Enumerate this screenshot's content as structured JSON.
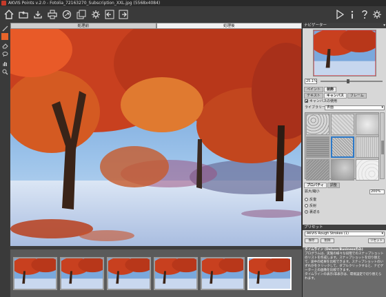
{
  "window": {
    "title": "AKVIS Points v.2.0 - Fotolia_72163270_Subscription_XXL.jpg (5568x4084)"
  },
  "toolbar": {
    "icons": [
      "home-icon",
      "open-icon",
      "save-icon",
      "print-icon",
      "share-icon",
      "batch-icon",
      "back-icon",
      "forward-icon",
      "run-icon",
      "info-icon",
      "help-icon",
      "settings-icon"
    ]
  },
  "view_tabs": {
    "before": "処理前",
    "after": "処理後"
  },
  "navigator": {
    "header": "ナビゲーター",
    "zoom": "25.1%"
  },
  "panel": {
    "tabs_top": [
      "ペイント",
      "装飾"
    ],
    "tabs_sub": [
      "テキスト",
      "キャンバス",
      "フレーム"
    ],
    "canvas_checkbox": "キャンバスの使用",
    "library_label": "ライブラリー",
    "library_value": "表面",
    "props_tabs": [
      "プロパティ",
      "調整"
    ],
    "scale_label": "拡大/縮小",
    "scale_value": "200%",
    "options": [
      "反復",
      "反射",
      "裏返る"
    ],
    "selected_option": 2
  },
  "presets": {
    "header": "プリセット",
    "value": "AKVIS Rough Strokes (1)",
    "save": "保存",
    "delete": "削除",
    "reset": "リセット"
  },
  "info": {
    "title": "タイムライン (Deluxe/Businessのみ)",
    "body": "プログラムは、実施の様々な段階でのスナップショットのリストを作成します。スナップショットを切り替えて、途中の結果を比較できます。スナップショットのいずれかをクリックして、ダブルクリックすると、ナビゲーター上の画像を比較できます。",
    "footer": "タイムラインの表示/非表示は、環境設定で切り替えられます。"
  },
  "timeline": {
    "count": 6,
    "active_index": 5
  },
  "colors": {
    "accent_orange": "#e8642a",
    "selection_blue": "#2c79c9",
    "panel_bg": "#d7d7d7",
    "app_bg": "#3d3d3d"
  }
}
